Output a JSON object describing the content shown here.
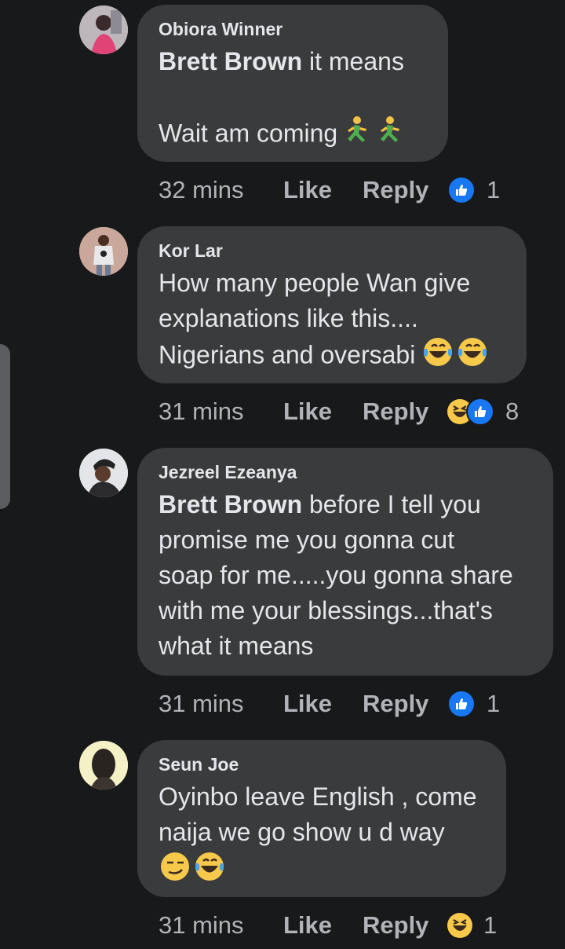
{
  "comments": [
    {
      "author": "Obiora Winner",
      "mention": "Brett Brown",
      "text_line1": " it means",
      "text_line2": "Wait am coming",
      "emoji_desc": "running-man-emoji",
      "time": "32 mins",
      "like": "Like",
      "reply": "Reply",
      "reaction_count": "1",
      "reactions": [
        "like"
      ]
    },
    {
      "author": "Kor Lar",
      "text_line1": "How many people Wan give",
      "text_line2": "explanations like this....",
      "text_line3": "Nigerians and oversabi",
      "emoji_desc": "tears-of-joy-emoji",
      "time": "31 mins",
      "like": "Like",
      "reply": "Reply",
      "reaction_count": "8",
      "reactions": [
        "haha",
        "like"
      ]
    },
    {
      "author": "Jezreel Ezeanya",
      "mention": "Brett Brown",
      "text_line1": " before I tell you",
      "text_line2": "promise me you gonna cut",
      "text_line3": "soap for me.....you gonna share",
      "text_line4": "with me your blessings...that's",
      "text_line5": "what it means",
      "time": "31 mins",
      "like": "Like",
      "reply": "Reply",
      "reaction_count": "1",
      "reactions": [
        "like"
      ]
    },
    {
      "author": "Seun Joe",
      "text_line1": "Oyinbo leave English , come",
      "text_line2": "naija we go show u d way",
      "emoji_desc": "smirk-and-tears-of-joy-emoji",
      "time": "31 mins",
      "like": "Like",
      "reply": "Reply",
      "reaction_count": "1",
      "reactions": [
        "haha"
      ]
    }
  ],
  "colors": {
    "background": "#18191a",
    "bubble": "#3a3b3c",
    "text": "#e4e6eb",
    "meta": "#b0b3b8",
    "like_blue": "#1877f2",
    "haha_yellow": "#f7c94b"
  }
}
